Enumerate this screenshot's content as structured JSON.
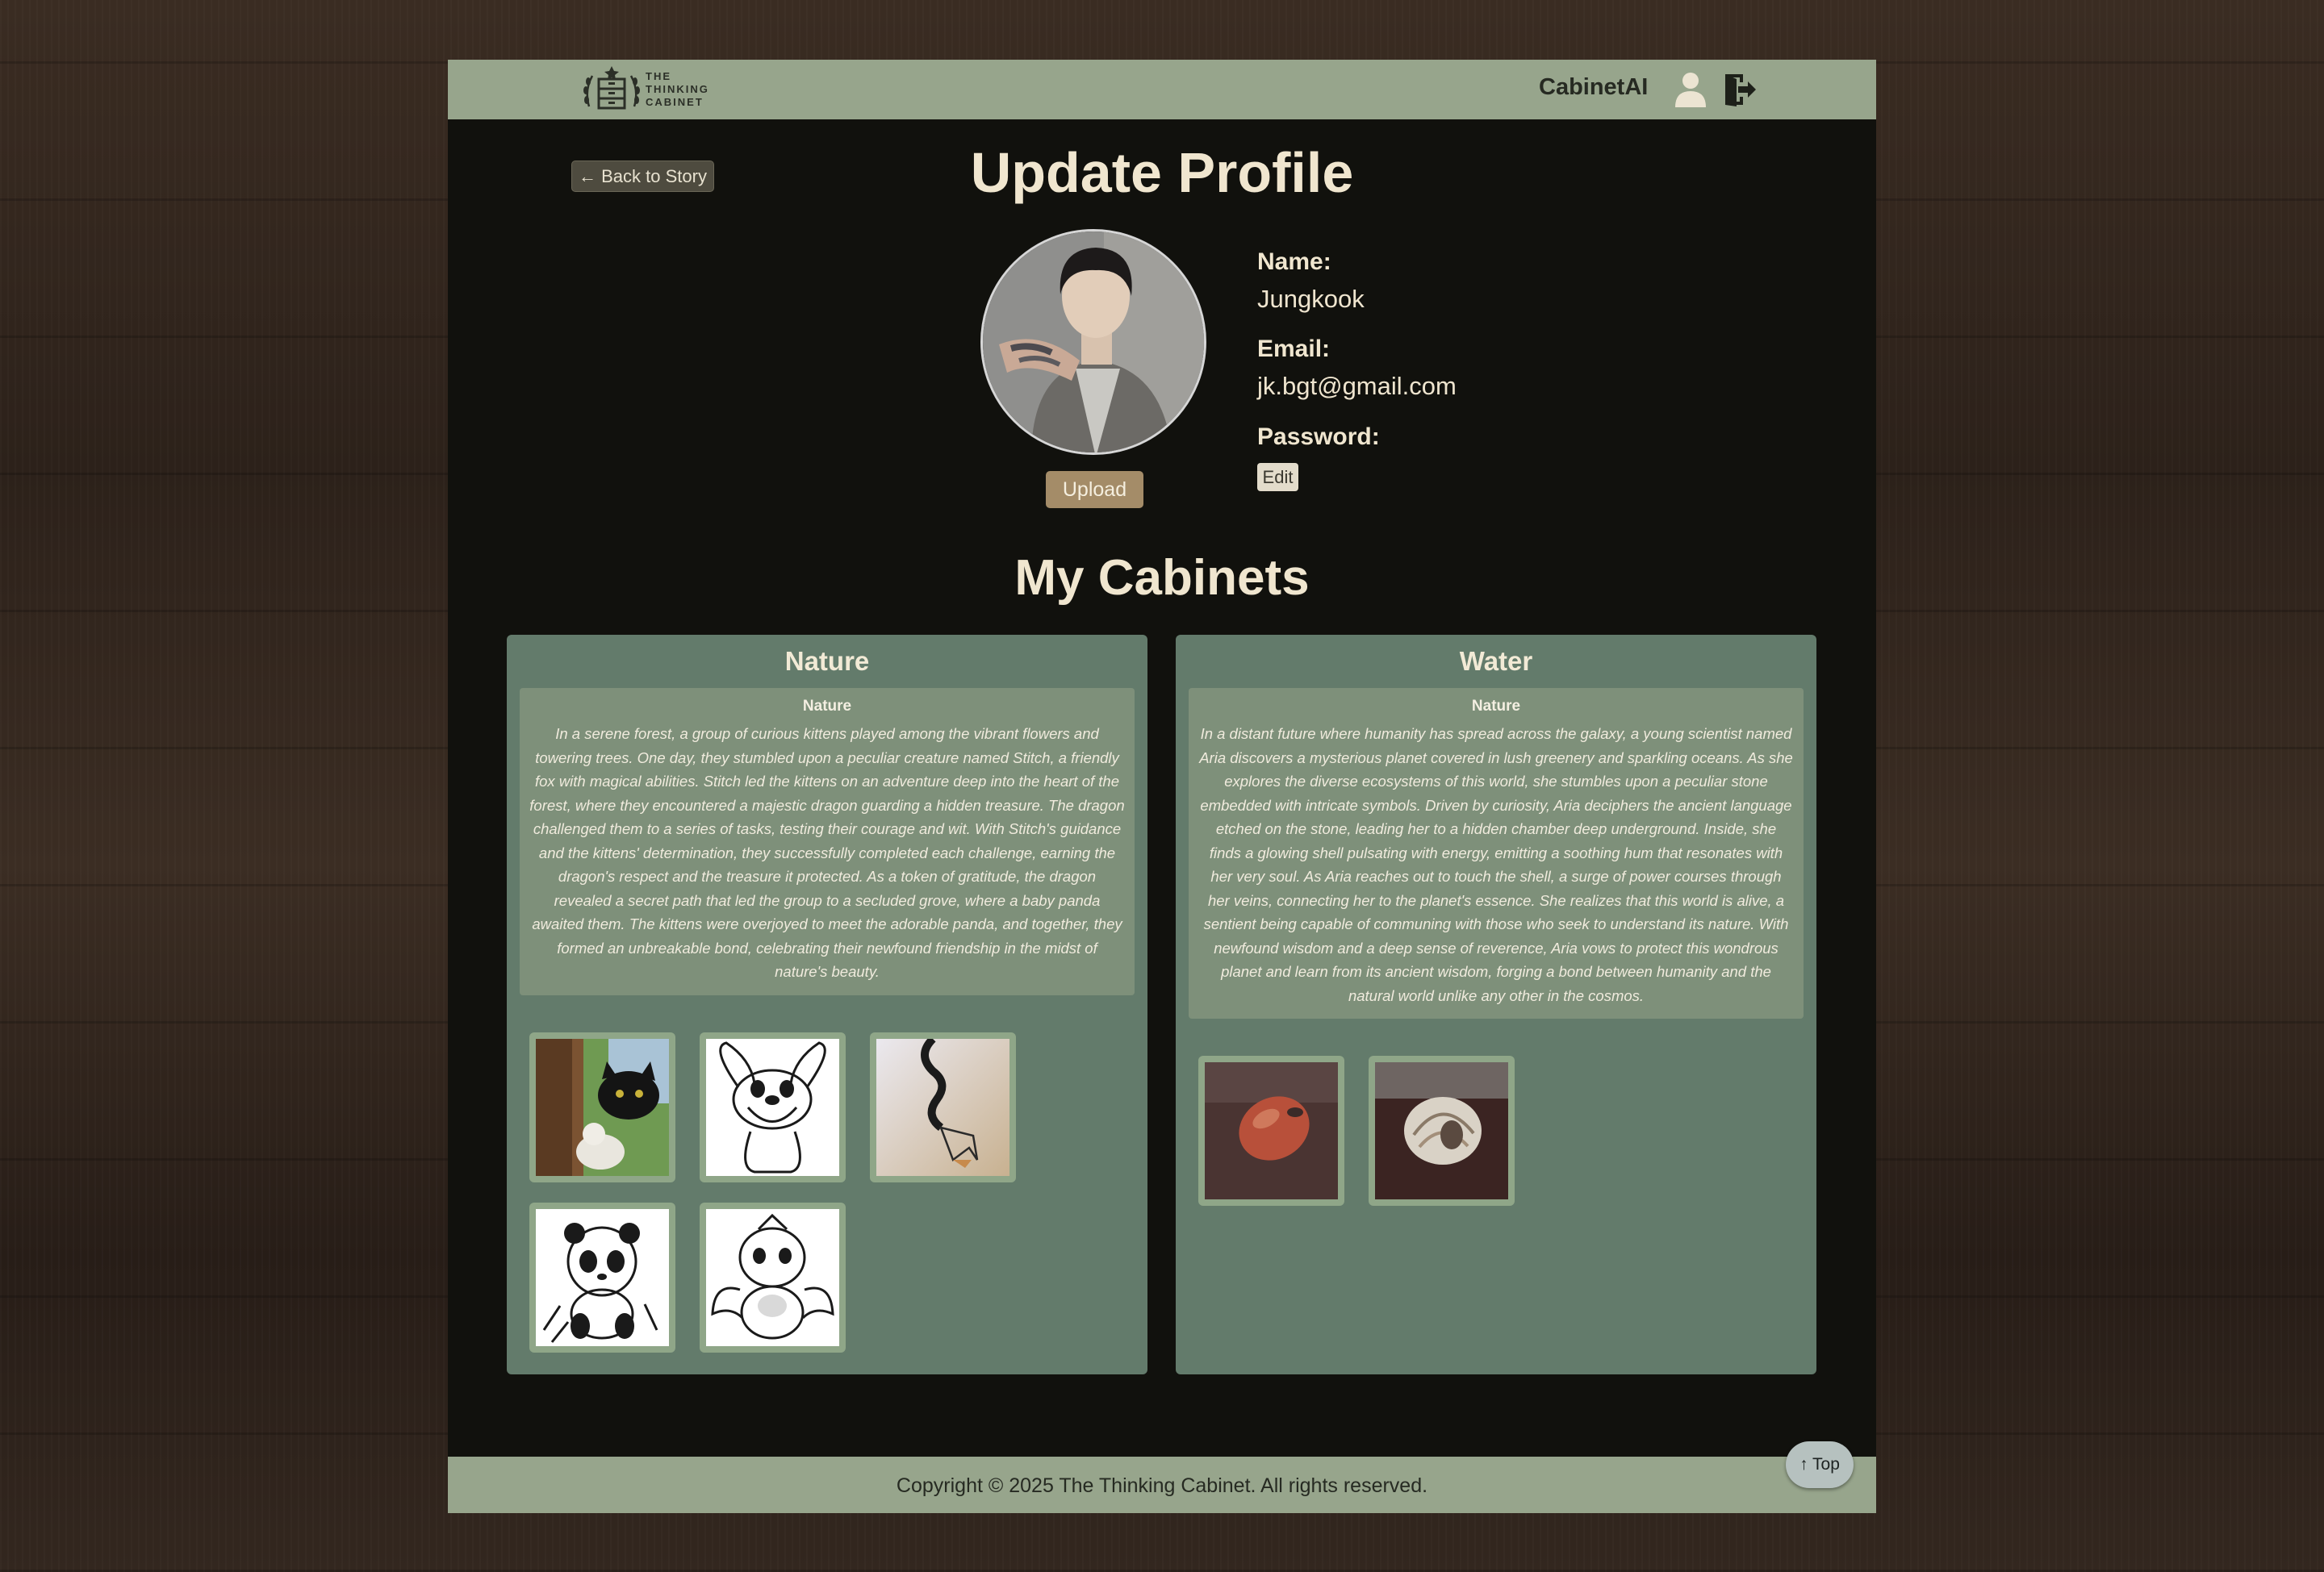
{
  "header": {
    "logo_lines": [
      "THE",
      "THINKING",
      "CABINET"
    ],
    "brand": "CabinetAI"
  },
  "profile": {
    "back_label": "← Back to Story",
    "title": "Update Profile",
    "upload_label": "Upload",
    "name_label": "Name:",
    "name_value": "Jungkook",
    "email_label": "Email:",
    "email_value": "jk.bgt@gmail.com",
    "password_label": "Password:",
    "edit_label": "Edit"
  },
  "cabinets_title": "My Cabinets",
  "cabinets": [
    {
      "title": "Nature",
      "story_title": "Nature",
      "story": "In a serene forest, a group of curious kittens played among the vibrant flowers and towering trees. One day, they stumbled upon a peculiar creature named Stitch, a friendly fox with magical abilities. Stitch led the kittens on an adventure deep into the heart of the forest, where they encountered a majestic dragon guarding a hidden treasure. The dragon challenged them to a series of tasks, testing their courage and wit. With Stitch's guidance and the kittens' determination, they successfully completed each challenge, earning the dragon's respect and the treasure it protected. As a token of gratitude, the dragon revealed a secret path that led the group to a secluded grove, where a baby panda awaited them. The kittens were overjoyed to meet the adorable panda, and together, they formed an unbreakable bond, celebrating their newfound friendship in the midst of nature's beauty.",
      "images": [
        "cat-photo",
        "stitch-drawing",
        "fox-drawing",
        "panda-drawing",
        "dragon-drawing"
      ]
    },
    {
      "title": "Water",
      "story_title": "Nature",
      "story": "In a distant future where humanity has spread across the galaxy, a young scientist named Aria discovers a mysterious planet covered in lush greenery and sparkling oceans. As she explores the diverse ecosystems of this world, she stumbles upon a peculiar stone embedded with intricate symbols. Driven by curiosity, Aria deciphers the ancient language etched on the stone, leading her to a hidden chamber deep underground. Inside, she finds a glowing shell pulsating with energy, emitting a soothing hum that resonates with her very soul. As Aria reaches out to touch the shell, a surge of power courses through her veins, connecting her to the planet's essence. She realizes that this world is alive, a sentient being capable of communing with those who seek to understand its nature. With newfound wisdom and a deep sense of reverence, Aria vows to protect this wondrous planet and learn from its ancient wisdom, forging a bond between humanity and the natural world unlike any other in the cosmos.",
      "images": [
        "red-stone-photo",
        "shell-photo"
      ]
    }
  ],
  "footer": {
    "copyright": "Copyright © 2025 The Thinking Cabinet. All rights reserved.",
    "top_label": "↑ Top"
  },
  "colors": {
    "header": "#97a58c",
    "page": "#11110d",
    "cabinet": "#637b6b",
    "story": "#7e907a",
    "upload": "#a48c68"
  }
}
